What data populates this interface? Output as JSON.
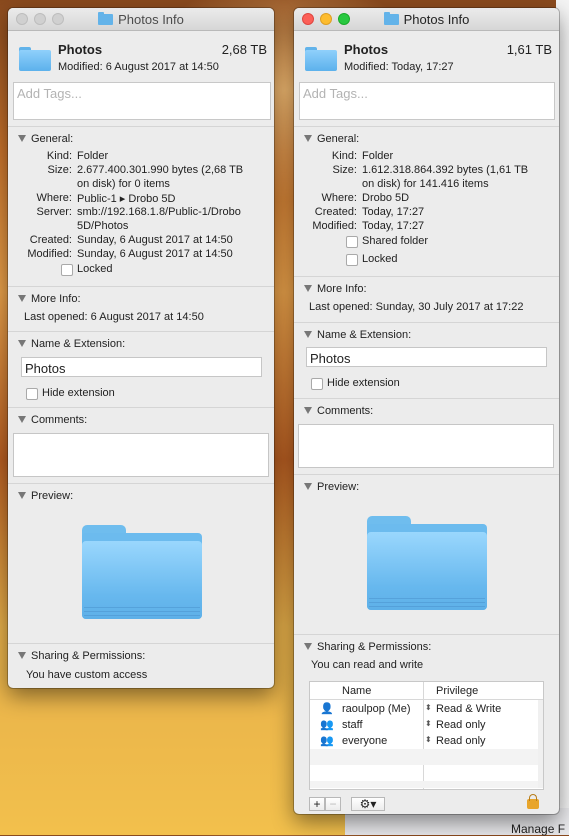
{
  "left_window": {
    "title": "Photos Info",
    "name": "Photos",
    "size": "2,68 TB",
    "modified": "Modified: 6 August 2017 at 14:50",
    "tags_placeholder": "Add Tags...",
    "general": {
      "heading": "General:",
      "kind_label": "Kind:",
      "kind": "Folder",
      "size_label": "Size:",
      "size_line1": "2.677.400.301.990 bytes (2,68 TB",
      "size_line2": "on disk) for 0 items",
      "where_label": "Where:",
      "where": "Public-1 ▸ Drobo 5D",
      "server_label": "Server:",
      "server_line1": "smb://192.168.1.8/Public-1/Drobo",
      "server_line2": "5D/Photos",
      "created_label": "Created:",
      "created": "Sunday, 6 August 2017 at 14:50",
      "modified_label": "Modified:",
      "modified": "Sunday, 6 August 2017 at 14:50",
      "locked_label": "Locked"
    },
    "more_info": {
      "heading": "More Info:",
      "last_opened": "Last opened: 6 August 2017 at 14:50"
    },
    "name_ext": {
      "heading": "Name & Extension:",
      "value": "Photos",
      "hide_label": "Hide extension"
    },
    "comments": {
      "heading": "Comments:"
    },
    "preview": {
      "heading": "Preview:"
    },
    "sharing": {
      "heading": "Sharing & Permissions:",
      "text": "You have custom access"
    }
  },
  "right_window": {
    "title": "Photos Info",
    "name": "Photos",
    "size": "1,61 TB",
    "modified": "Modified: Today, 17:27",
    "tags_placeholder": "Add Tags...",
    "general": {
      "heading": "General:",
      "kind_label": "Kind:",
      "kind": "Folder",
      "size_label": "Size:",
      "size_line1": "1.612.318.864.392 bytes (1,61 TB",
      "size_line2": "on disk) for 141.416 items",
      "where_label": "Where:",
      "where": "Drobo 5D",
      "created_label": "Created:",
      "created": "Today, 17:27",
      "modified_label": "Modified:",
      "modified": "Today, 17:27",
      "shared_label": "Shared folder",
      "locked_label": "Locked"
    },
    "more_info": {
      "heading": "More Info:",
      "last_opened": "Last opened: Sunday, 30 July 2017 at 17:22"
    },
    "name_ext": {
      "heading": "Name & Extension:",
      "value": "Photos",
      "hide_label": "Hide extension"
    },
    "comments": {
      "heading": "Comments:"
    },
    "preview": {
      "heading": "Preview:"
    },
    "sharing": {
      "heading": "Sharing & Permissions:",
      "text": "You can read and write",
      "col_name": "Name",
      "col_privilege": "Privilege",
      "rows": [
        {
          "icon": "user-icon",
          "name": "raoulpop (Me)",
          "privilege": "Read & Write"
        },
        {
          "icon": "group-icon",
          "name": "staff",
          "privilege": "Read only"
        },
        {
          "icon": "everyone-icon",
          "name": "everyone",
          "privilege": "Read only"
        }
      ],
      "add": "+",
      "remove": "−",
      "action": "⚙▾"
    }
  },
  "background": {
    "partial_text": "Manage F"
  }
}
